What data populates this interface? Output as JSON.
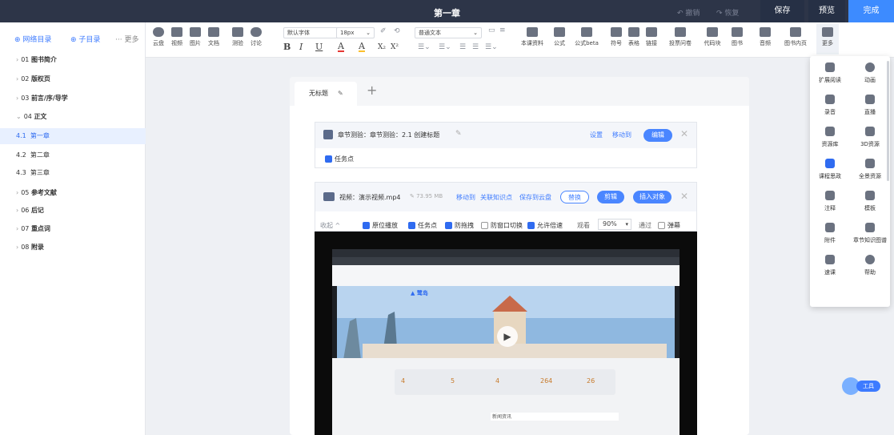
{
  "topbar": {
    "title": "第一章",
    "undo": "↶ 撤销",
    "redo": "↷ 恢复",
    "save": "保存",
    "preview": "预览",
    "done": "完成"
  },
  "outline": {
    "add_outline": "⊕ 网络目录",
    "add_sub": "⊕ 子目录",
    "more": "··· 更多",
    "items": [
      {
        "num": "01",
        "label": "图书简介",
        "arrow": "›"
      },
      {
        "num": "02",
        "label": "版权页",
        "arrow": "›"
      },
      {
        "num": "03",
        "label": "前言/序/导学",
        "arrow": "›"
      },
      {
        "num": "04",
        "label": "正文",
        "arrow": "⌄"
      },
      {
        "num": "4.1",
        "label": "第一章",
        "arrow": ""
      },
      {
        "num": "4.2",
        "label": "第二章",
        "arrow": ""
      },
      {
        "num": "4.3",
        "label": "第三章",
        "arrow": ""
      },
      {
        "num": "05",
        "label": "参考文献",
        "arrow": "›"
      },
      {
        "num": "06",
        "label": "后记",
        "arrow": "›"
      },
      {
        "num": "07",
        "label": "重点词",
        "arrow": "›"
      },
      {
        "num": "08",
        "label": "附录",
        "arrow": "›"
      }
    ]
  },
  "toolbar": {
    "left_tools": [
      "云盘",
      "视频",
      "图片",
      "文档",
      "测验",
      "讨论"
    ],
    "font_family": "默认字体",
    "font_size": "18px",
    "paragraph": "普通文本",
    "format_buttons": [
      "B",
      "I",
      "U",
      "A",
      "A",
      "X₂",
      "X²"
    ],
    "right_tools": [
      "本课资料",
      "公式",
      "公式beta",
      "符号",
      "表格",
      "链接",
      "投票问卷",
      "代码块",
      "图书",
      "音频",
      "图书内页",
      "更多"
    ]
  },
  "editor": {
    "tab_label": "无标题",
    "add_tab": "+",
    "quiz": {
      "title": "章节测验：章节测验：2.1 创建标题",
      "settings": "设置",
      "move": "移动到",
      "edit": "编辑",
      "task_point": "任务点"
    },
    "video": {
      "title": "视频：演示视频.mp4",
      "size": "73.95 MB",
      "move": "移动到",
      "link_knowledge": "关联知识点",
      "save_cloud": "保存到云盘",
      "replace": "替换",
      "edit": "剪辑",
      "insert_object": "插入对象",
      "collapse": "收起 ^",
      "options": [
        {
          "label": "原位播放",
          "checked": true
        },
        {
          "label": "任务点",
          "checked": true
        },
        {
          "label": "防拖拽",
          "checked": true
        },
        {
          "label": "防窗口切换",
          "checked": false
        },
        {
          "label": "允许倍速",
          "checked": true
        }
      ],
      "watch_label": "观看",
      "watch_percent": "90%",
      "pass_label": "通过",
      "popup_label": "弹幕",
      "popup_checked": false,
      "screen_stats": [
        "4",
        "5",
        "4",
        "264",
        "26"
      ],
      "screen_button": "新闻资讯"
    }
  },
  "more_panel": {
    "items": [
      "扩展阅读",
      "动画",
      "录音",
      "直播",
      "资源库",
      "3D资源",
      "课程思政",
      "全景资源",
      "注释",
      "模板",
      "附件",
      "章节知识图谱",
      "速课",
      "帮助"
    ]
  },
  "float": {
    "label": "工具"
  },
  "colors": {
    "accent": "#3d8bff",
    "topbar": "#2d3548"
  }
}
